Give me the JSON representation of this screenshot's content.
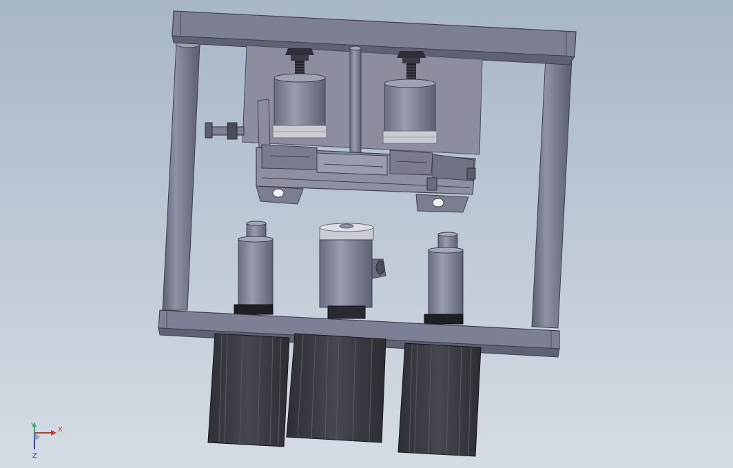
{
  "viewport": {
    "background_top": "#a7b6c8",
    "background_bottom": "#d4dbe3",
    "colors": {
      "frame_plate": "#7b7e91",
      "frame_edge": "#4a4c5a",
      "mount_plate": "#8b8d9e",
      "cylinder_body": "#83869a",
      "ring_band": "#c9ccd2",
      "nut_dark": "#2e2f38",
      "motor_body": "#3a3b42",
      "motor_rib": "#55565f"
    },
    "components": [
      "top-plate",
      "left-column",
      "right-column",
      "upper-mount-plate",
      "left-upper-cylinder",
      "right-upper-cylinder",
      "center-rod",
      "gripper-jaw-assembly",
      "side-bolt",
      "bottom-plate",
      "left-lower-cylinder",
      "center-lower-cylinder",
      "right-lower-cylinder",
      "left-stepper-motor",
      "center-stepper-motor",
      "right-stepper-motor"
    ]
  },
  "triad": {
    "x_label": "X",
    "y_label": "Y",
    "z_label": "Z",
    "x_color": "#c0392b",
    "y_color": "#27ae60",
    "z_color": "#2346b8"
  }
}
